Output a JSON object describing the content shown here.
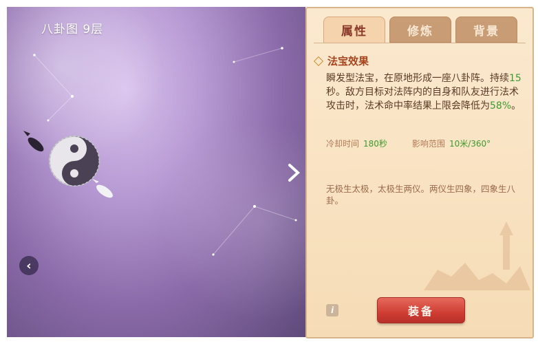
{
  "artifact_title": "八卦图 9层",
  "tabs": [
    {
      "label": "属性",
      "active": true
    },
    {
      "label": "修炼",
      "active": false
    },
    {
      "label": "背景",
      "active": false
    }
  ],
  "effect": {
    "title": "法宝效果",
    "line1": "瞬发型法宝，在原地形成一座八卦阵。持续",
    "duration": "15",
    "line2": "秒。敌方目标对法阵内的自身和队友进行法术攻击时，法术命中率结果上限会降低为",
    "percent": "58%",
    "line3": "。"
  },
  "stats": {
    "cooldown_label": "冷却时间",
    "cooldown_value": "180秒",
    "range_label": "影响范围",
    "range_value": "10米/360°"
  },
  "lore": "无极生太极，太极生两仪。两仪生四象，四象生八卦。",
  "buttons": {
    "equip": "装备",
    "info": "i",
    "prev": "‹",
    "next": "›"
  },
  "colors": {
    "accent_red": "#cf3d33",
    "highlight_green": "#3c9b2e",
    "title_red": "#a8451f"
  }
}
